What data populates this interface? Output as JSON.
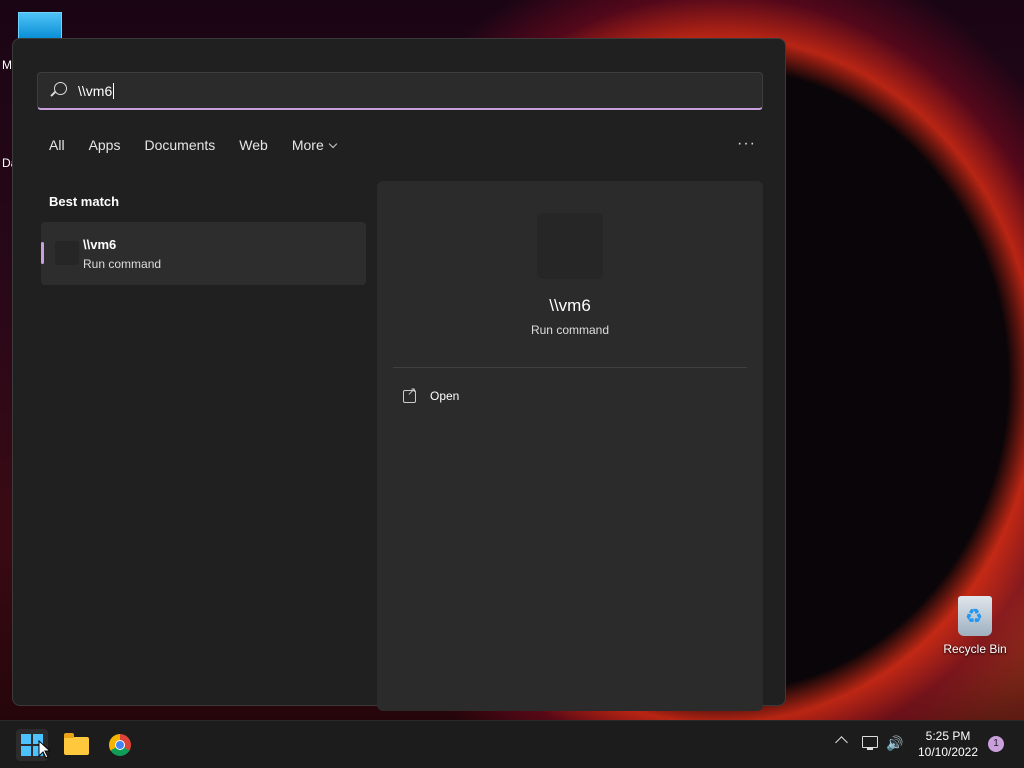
{
  "desktop": {
    "edge_label_1": "M",
    "edge_label_2": "Da",
    "recycle_bin_label": "Recycle Bin"
  },
  "search": {
    "query": "\\\\vm6"
  },
  "filters": {
    "tabs": [
      "All",
      "Apps",
      "Documents",
      "Web",
      "More"
    ],
    "more_options_glyph": "···"
  },
  "results": {
    "section_header": "Best match",
    "best_match": {
      "title": "\\\\vm6",
      "subtitle": "Run command"
    }
  },
  "detail": {
    "name": "\\\\vm6",
    "type": "Run command",
    "actions": [
      "Open"
    ]
  },
  "taskbar": {
    "pinned": [
      "start-icon",
      "file-explorer-icon",
      "chrome-icon"
    ],
    "tray": {
      "time": "5:25 PM",
      "date": "10/10/2022",
      "notification_count": "1"
    }
  },
  "colors": {
    "accent": "#c9a0dc",
    "panel_bg": "#202020",
    "taskbar_bg": "#1c1c1c"
  }
}
